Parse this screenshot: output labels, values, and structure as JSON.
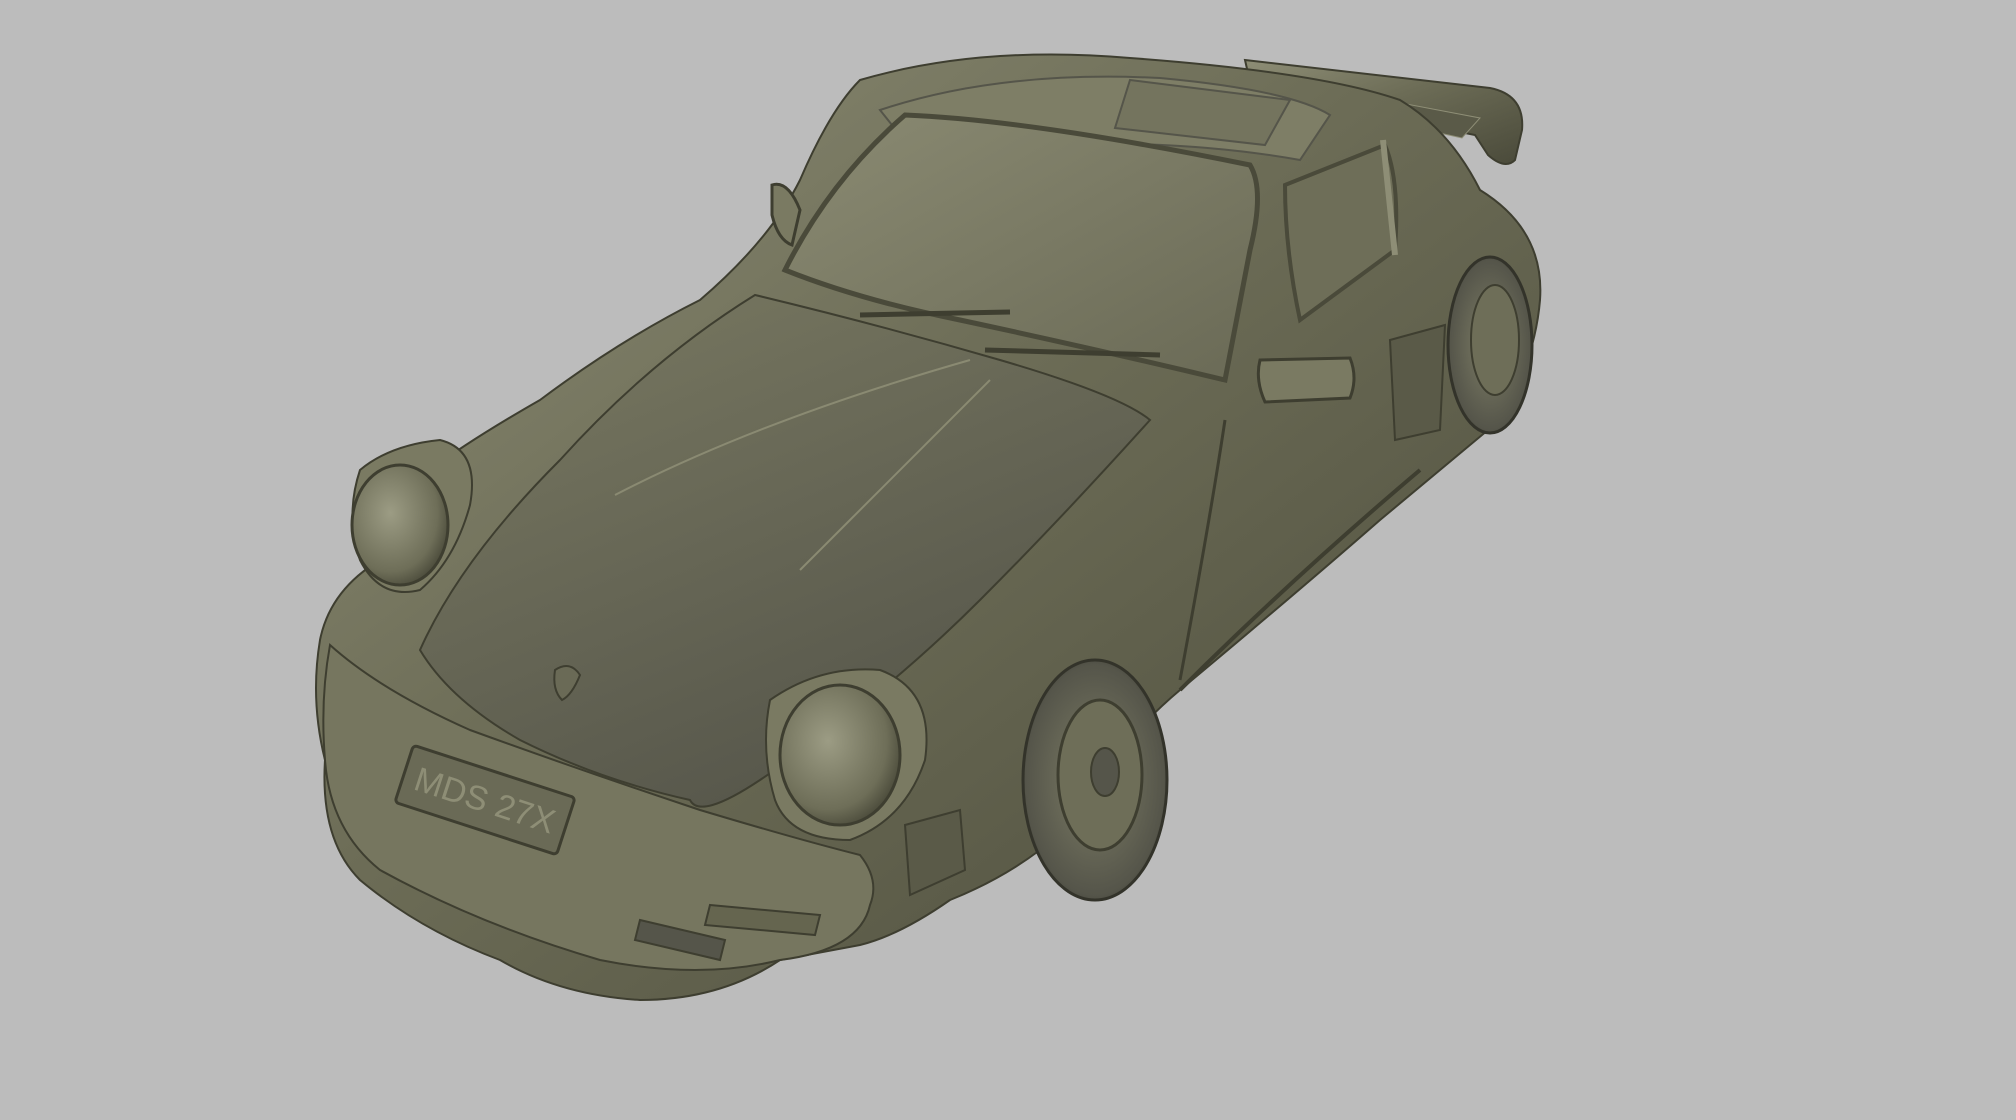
{
  "viewport": {
    "background_color": "#bcbcbc",
    "model_color": "#6e6e58",
    "model_highlight_color": "#a8a890",
    "model_shadow_color": "#3e3e30"
  },
  "model": {
    "license_plate_text": "MDS 27X"
  }
}
